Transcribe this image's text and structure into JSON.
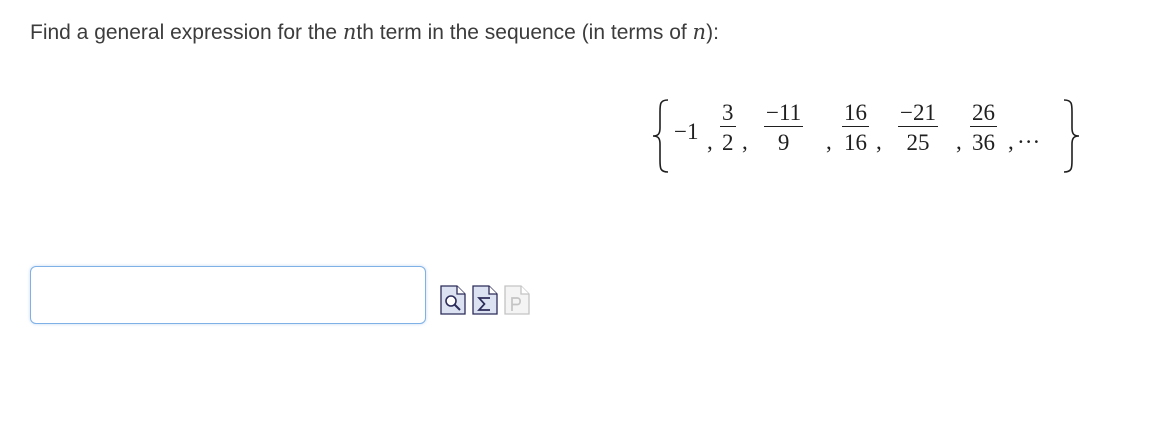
{
  "question": {
    "prefix": "Find a general expression for the ",
    "var1": "n",
    "middle": "th term in the sequence (in terms of ",
    "var2": "n",
    "suffix": "):"
  },
  "sequence": {
    "first_term": "−1",
    "fractions": [
      {
        "numerator": "3",
        "denominator": "2"
      },
      {
        "numerator": "−11",
        "denominator": "9"
      },
      {
        "numerator": "16",
        "denominator": "16"
      },
      {
        "numerator": "−21",
        "denominator": "25"
      },
      {
        "numerator": "26",
        "denominator": "36"
      }
    ],
    "comma": ",",
    "ellipsis": "..."
  },
  "answer": {
    "value": "",
    "placeholder": ""
  },
  "tools": [
    {
      "name": "preview-icon",
      "glyph": "🔍"
    },
    {
      "name": "equation-editor-icon",
      "glyph": "Σ"
    },
    {
      "name": "paste-icon",
      "glyph": "P"
    }
  ],
  "colors": {
    "input_border": "#7fb0e6",
    "icon_active": "#2c2c5a",
    "icon_disabled": "#c4c4c4",
    "icon_fill": "#d9def0"
  }
}
